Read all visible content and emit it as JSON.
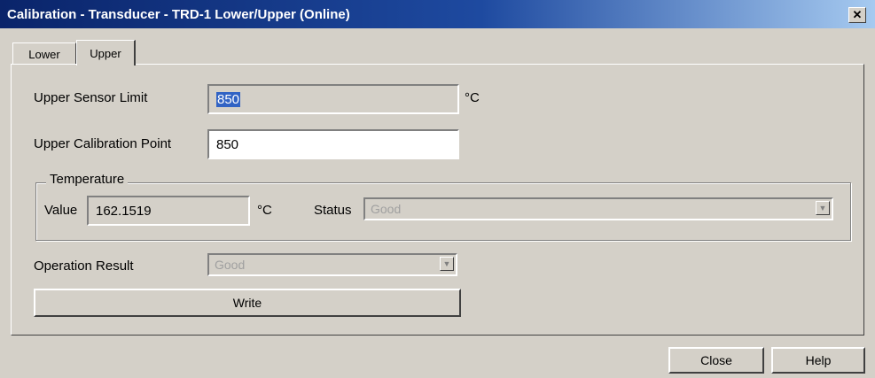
{
  "window": {
    "title": "Calibration - Transducer - TRD-1 Lower/Upper  (Online)",
    "close_glyph": "✕"
  },
  "tabs": [
    {
      "label": "Lower"
    },
    {
      "label": "Upper"
    }
  ],
  "upper_sensor_limit": {
    "label": "Upper Sensor Limit",
    "value": "850",
    "unit": "°C"
  },
  "upper_calibration_point": {
    "label": "Upper Calibration Point",
    "value": "850"
  },
  "temperature": {
    "group_label": "Temperature",
    "value_label": "Value",
    "value": "162.1519",
    "unit": "°C",
    "status_label": "Status",
    "status_value": "Good"
  },
  "operation_result": {
    "label": "Operation Result",
    "value": "Good"
  },
  "buttons": {
    "write": "Write",
    "close": "Close",
    "help": "Help"
  }
}
